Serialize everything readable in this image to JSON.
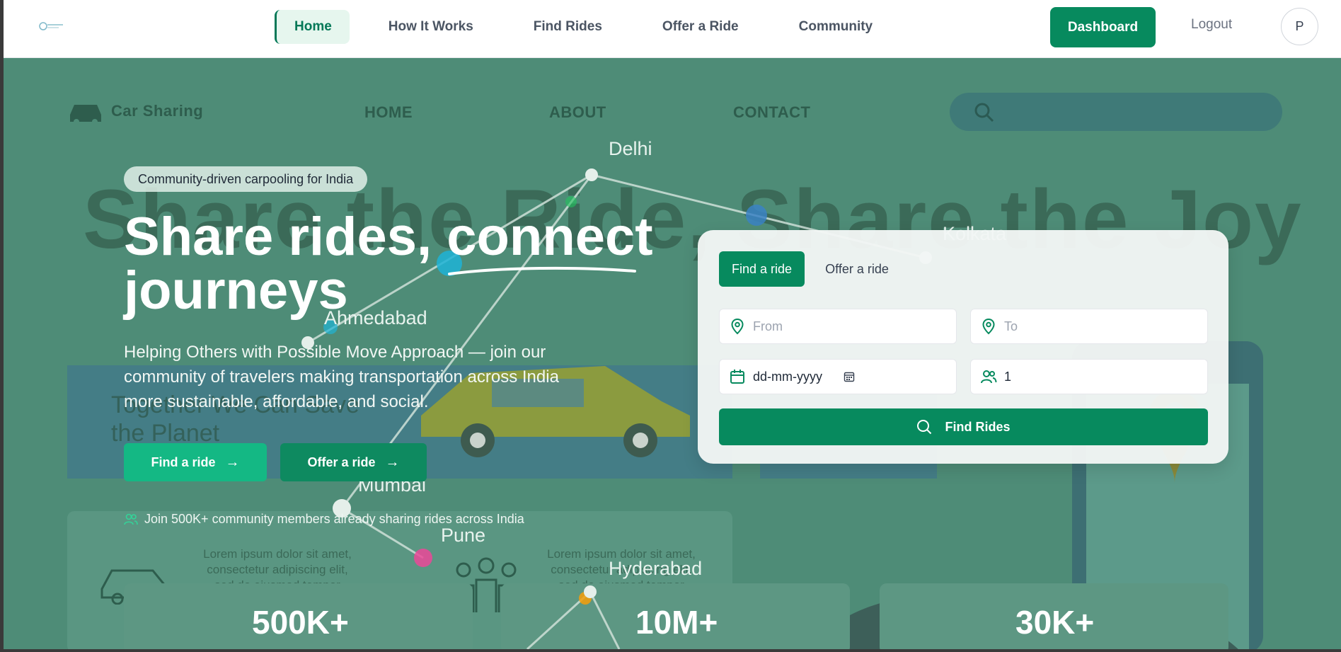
{
  "navbar": {
    "links": [
      "Home",
      "How It Works",
      "Find Rides",
      "Offer a Ride",
      "Community"
    ],
    "active": "Home",
    "dashboard_label": "Dashboard",
    "logout_label": "Logout",
    "avatar_initial": "P"
  },
  "background": {
    "brand": "Car Sharing",
    "nav": [
      "HOME",
      "ABOUT",
      "CONTACT"
    ],
    "headline": "Share the Ride, Share the Joy",
    "banner_text": "Together We Can Save the Planet",
    "lorem_1": "Lorem ipsum dolor sit amet, consectetur adipiscing elit, sed do eiusmod tempor incididunt ut",
    "lorem_2": "Lorem ipsum dolor sit amet, consectetur adipiscing elit, sed do eiusmod tempor incididunt ut"
  },
  "map": {
    "cities": [
      "Delhi",
      "Kolkata",
      "Ahmedabad",
      "Mumbai",
      "Pune",
      "Hyderabad"
    ]
  },
  "hero": {
    "pill": "Community-driven carpooling for India",
    "headline_part1": "Share rides, ",
    "headline_highlight": "connect",
    "headline_part2": "journeys",
    "subtext": "Helping Others with Possible Move Approach — join our community of travelers making transportation across India more sustainable, affordable, and social.",
    "find_btn": "Find a ride",
    "offer_btn": "Offer a ride",
    "community": "Join 500K+ community members already sharing rides across India"
  },
  "stats": [
    "500K+",
    "10M+",
    "30K+"
  ],
  "search_card": {
    "tab_find": "Find a ride",
    "tab_offer": "Offer a ride",
    "from_placeholder": "From",
    "to_placeholder": "To",
    "date_value": "dd-mm-yyyy",
    "passengers_value": "1",
    "submit_label": "Find Rides"
  },
  "colors": {
    "primary": "#078a5e",
    "accent": "#14b884",
    "hero_overlay": "#4e8c77"
  }
}
